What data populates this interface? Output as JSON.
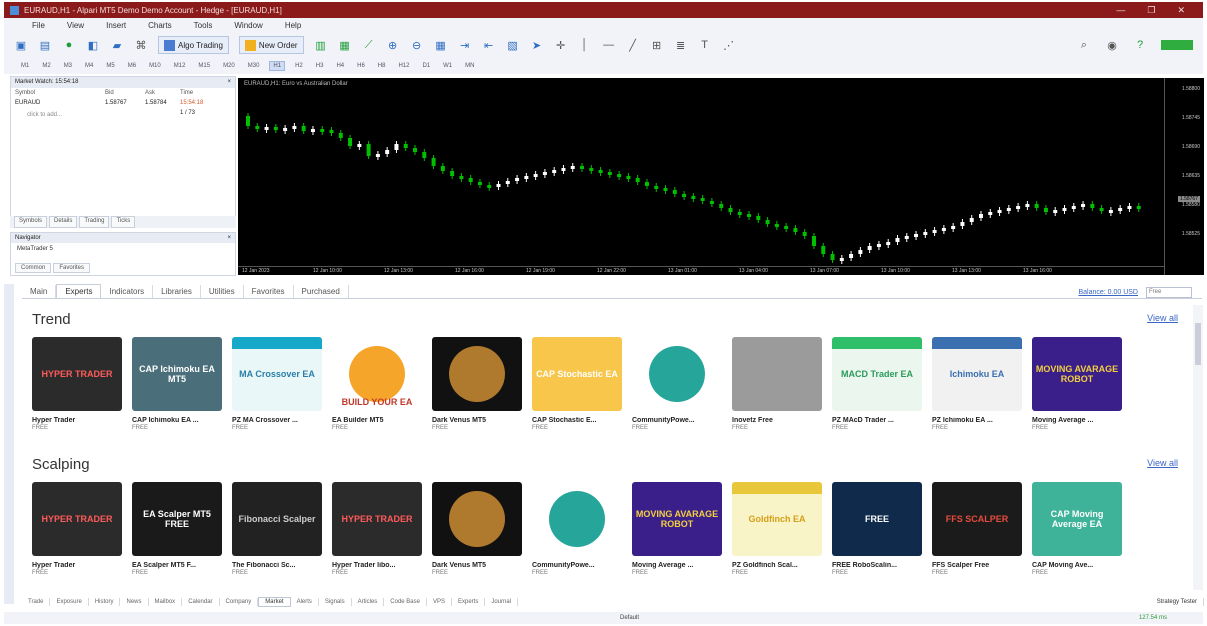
{
  "window": {
    "title": "EURAUD,H1 - Alpari MT5 Demo Demo Account - Hedge - [EURAUD,H1]",
    "controls": [
      "—",
      "❐",
      "✕"
    ]
  },
  "menu": [
    "File",
    "View",
    "Insert",
    "Charts",
    "Tools",
    "Window",
    "Help"
  ],
  "toolbar": {
    "algo_trading_label": "Algo Trading",
    "new_order_label": "New Order"
  },
  "timeframes": [
    "M1",
    "M2",
    "M3",
    "M4",
    "M5",
    "M6",
    "M10",
    "M12",
    "M15",
    "M20",
    "M30",
    "H1",
    "H2",
    "H3",
    "H4",
    "H6",
    "H8",
    "H12",
    "D1",
    "W1",
    "MN"
  ],
  "active_timeframe": "H1",
  "market_watch": {
    "header": "Market Watch: 15:54:18",
    "columns": [
      "Symbol",
      "Bid",
      "Ask",
      "Time"
    ],
    "rows": [
      {
        "symbol": "EURAUD",
        "bid": "1.58767",
        "ask": "1.58784",
        "time": "15:54:18"
      }
    ],
    "add_label": "click to add...",
    "count": "1 / 73",
    "tabs": [
      "Symbols",
      "Details",
      "Trading",
      "Ticks"
    ]
  },
  "navigator": {
    "header": "Navigator",
    "item": "MetaTrader 5",
    "tabs": [
      "Common",
      "Favorites"
    ]
  },
  "chart": {
    "title": "EURAUD,H1: Euro vs Australian Dollar",
    "price_ticks": [
      "1.58800",
      "1.58745",
      "1.58690",
      "1.58635",
      "1.58580",
      "1.58525"
    ],
    "current_price": "1.58767",
    "time_ticks": [
      "12 Jan 2023",
      "12 Jan 10:00",
      "12 Jan 13:00",
      "12 Jan 16:00",
      "12 Jan 19:00",
      "12 Jan 22:00",
      "13 Jan 01:00",
      "13 Jan 04:00",
      "13 Jan 07:00",
      "13 Jan 10:00",
      "13 Jan 13:00",
      "13 Jan 16:00"
    ],
    "bg": "#000000",
    "bull_color": "#ffffff",
    "bear_color": "#00c000"
  },
  "market_tabs": [
    "Main",
    "Experts",
    "Indicators",
    "Libraries",
    "Utilities",
    "Favorites",
    "Purchased"
  ],
  "active_market_tab": "Experts",
  "balance": "Balance: 0.00 USD",
  "search_placeholder": "Free",
  "sections": [
    {
      "title": "Trend",
      "view_all": "View all",
      "cards": [
        {
          "name": "Hyper Trader",
          "price": "FREE",
          "style": "hyper",
          "caption": "HYPER TRADER"
        },
        {
          "name": "CAP Ichimoku EA ...",
          "price": "FREE",
          "style": "cap",
          "caption": "CAP Ichimoku EA MT5"
        },
        {
          "name": "PZ MA Crossover ...",
          "price": "FREE",
          "style": "pzcyan",
          "caption": "MA Crossover EA"
        },
        {
          "name": "EA Builder MT5",
          "price": "FREE",
          "style": "builder",
          "caption": "BUILD YOUR EA"
        },
        {
          "name": "Dark Venus MT5",
          "price": "FREE",
          "style": "venus",
          "caption": ""
        },
        {
          "name": "CAP Stochastic E...",
          "price": "FREE",
          "style": "capstoch",
          "caption": "CAP Stochastic EA"
        },
        {
          "name": "CommunityPowe...",
          "price": "FREE",
          "style": "community",
          "caption": ""
        },
        {
          "name": "Inovetz Free",
          "price": "FREE",
          "style": "inovetz",
          "caption": ""
        },
        {
          "name": "PZ MAcD Trader ...",
          "price": "FREE",
          "style": "pzmacd",
          "caption": "MACD Trader EA"
        },
        {
          "name": "PZ Ichimoku EA ...",
          "price": "FREE",
          "style": "pzichi",
          "caption": "Ichimoku EA"
        },
        {
          "name": "Moving Average ...",
          "price": "FREE",
          "style": "movavg",
          "caption": "MOVING AVARAGE ROBOT"
        }
      ]
    },
    {
      "title": "Scalping",
      "view_all": "View all",
      "cards": [
        {
          "name": "Hyper Trader",
          "price": "FREE",
          "style": "hyper",
          "caption": "HYPER TRADER"
        },
        {
          "name": "EA Scalper MT5 F...",
          "price": "FREE",
          "style": "scalper",
          "caption": "EA Scalper MT5 FREE"
        },
        {
          "name": "The Fibonacci Sc...",
          "price": "FREE",
          "style": "fibo",
          "caption": "Fibonacci Scalper"
        },
        {
          "name": "Hyper Trader libo...",
          "price": "FREE",
          "style": "hyper",
          "caption": "HYPER TRADER"
        },
        {
          "name": "Dark Venus MT5",
          "price": "FREE",
          "style": "venus",
          "caption": ""
        },
        {
          "name": "CommunityPowe...",
          "price": "FREE",
          "style": "community",
          "caption": ""
        },
        {
          "name": "Moving Average ...",
          "price": "FREE",
          "style": "movavg",
          "caption": "MOVING AVARAGE ROBOT"
        },
        {
          "name": "PZ Goldfinch Scal...",
          "price": "FREE",
          "style": "goldfinch",
          "caption": "Goldfinch EA"
        },
        {
          "name": "FREE RoboScalin...",
          "price": "FREE",
          "style": "robo",
          "caption": "FREE"
        },
        {
          "name": "FFS Scalper Free",
          "price": "FREE",
          "style": "ffs",
          "caption": "FFS SCALPER"
        },
        {
          "name": "CAP Moving Ave...",
          "price": "FREE",
          "style": "capma",
          "caption": "CAP Moving Average EA"
        }
      ]
    }
  ],
  "bottom_tabs": [
    "Trade",
    "Exposure",
    "History",
    "News",
    "Mailbox",
    "Calendar",
    "Company",
    "Market",
    "Alerts",
    "Signals",
    "Articles",
    "Code Base",
    "VPS",
    "Experts",
    "Journal"
  ],
  "active_bottom_tab": "Market",
  "strategy_tester": "Strategy Tester",
  "status": {
    "profile": "Default",
    "ping": "127.54 ms"
  }
}
